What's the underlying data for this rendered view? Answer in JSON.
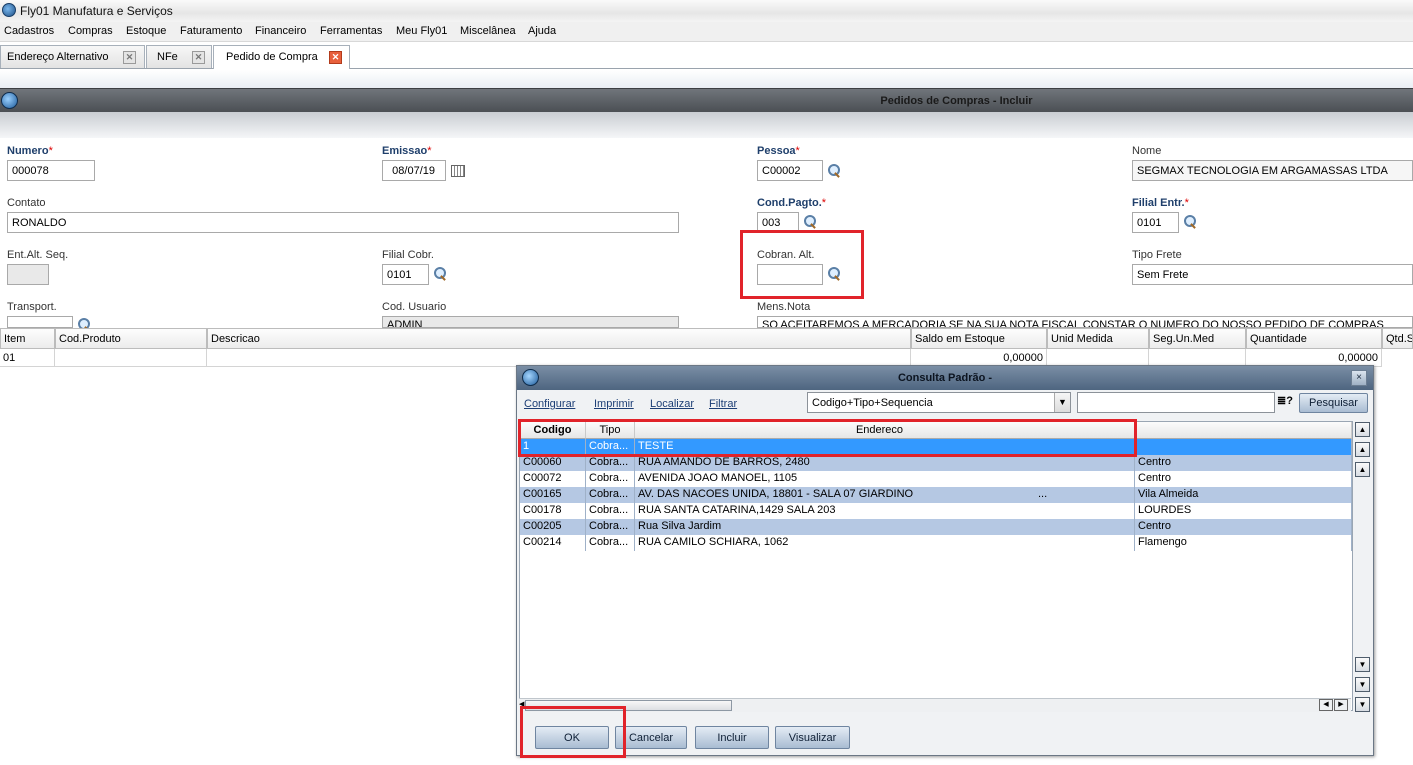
{
  "window": {
    "title": "Fly01 Manufatura e Serviços"
  },
  "menu": [
    "Cadastros",
    "Compras",
    "Estoque",
    "Faturamento",
    "Financeiro",
    "Ferramentas",
    "Meu Fly01",
    "Miscelânea",
    "Ajuda"
  ],
  "tabs": [
    {
      "label": "Endereço Alternativo"
    },
    {
      "label": "NFe"
    },
    {
      "label": "Pedido de Compra"
    }
  ],
  "form": {
    "title": "Pedidos de Compras - Incluir",
    "numero": {
      "label": "Numero",
      "value": "000078"
    },
    "emissao": {
      "label": "Emissao",
      "value": "08/07/19"
    },
    "pessoa": {
      "label": "Pessoa",
      "value": "C00002"
    },
    "nome": {
      "label": "Nome",
      "value": "SEGMAX TECNOLOGIA EM ARGAMASSAS LTDA"
    },
    "contato": {
      "label": "Contato",
      "value": "RONALDO"
    },
    "cond_pagto": {
      "label": "Cond.Pagto.",
      "value": "003"
    },
    "filial_entr": {
      "label": "Filial Entr.",
      "value": "0101"
    },
    "ent_alt_seq": {
      "label": "Ent.Alt. Seq.",
      "value": ""
    },
    "filial_cobr": {
      "label": "Filial Cobr.",
      "value": "0101"
    },
    "cobran_alt": {
      "label": "Cobran. Alt.",
      "value": ""
    },
    "tipo_frete": {
      "label": "Tipo Frete",
      "value": "Sem Frete"
    },
    "transport": {
      "label": "Transport.",
      "value": ""
    },
    "cod_usuario": {
      "label": "Cod. Usuario",
      "value": "ADMIN"
    },
    "mens_nota": {
      "label": "Mens.Nota",
      "value": "SO ACEITAREMOS A MERCADORIA SE NA SUA NOTA FISCAL CONSTAR O NUMERO DO NOSSO PEDIDO DE COMPRAS"
    },
    "required_mark": "*"
  },
  "grid": {
    "headers": [
      "Item",
      "Cod.Produto",
      "Descricao",
      "Saldo em Estoque",
      "Unid Medida",
      "Seg.Un.Med",
      "Quantidade",
      "Qtd.S"
    ],
    "row": [
      "01",
      "",
      "",
      "0,00000",
      "",
      "",
      "0,00000",
      ""
    ]
  },
  "dialog": {
    "title": "Consulta Padrão -",
    "close": "×",
    "links": [
      "Configurar",
      "Imprimir",
      "Localizar",
      "Filtrar"
    ],
    "order_select": "Codigo+Tipo+Sequencia",
    "search_value": "",
    "search_button": "Pesquisar",
    "columns": [
      "Codigo",
      "Tipo",
      "Endereco"
    ],
    "rows": [
      {
        "codigo": "1",
        "tipo": "Cobra...",
        "endereco": "TESTE",
        "bairro": "",
        "selected": true
      },
      {
        "codigo": "C00060",
        "tipo": "Cobra...",
        "endereco": "RUA AMANDO DE BARROS, 2480",
        "bairro": "Centro"
      },
      {
        "codigo": "C00072",
        "tipo": "Cobra...",
        "endereco": "AVENIDA JOAO MANOEL, 1105",
        "bairro": "Centro"
      },
      {
        "codigo": "C00165",
        "tipo": "Cobra...",
        "endereco": "AV. DAS NACOES UNIDA, 18801 - SALA 07 GIARDINO",
        "extra": "...",
        "bairro": "Vila Almeida"
      },
      {
        "codigo": "C00178",
        "tipo": "Cobra...",
        "endereco": "RUA SANTA CATARINA,1429 SALA 203",
        "bairro": "LOURDES"
      },
      {
        "codigo": "C00205",
        "tipo": "Cobra...",
        "endereco": "Rua Silva Jardim",
        "bairro": "Centro"
      },
      {
        "codigo": "C00214",
        "tipo": "Cobra...",
        "endereco": "RUA CAMILO SCHIARA, 1062",
        "bairro": "Flamengo"
      }
    ],
    "buttons": {
      "ok": "OK",
      "cancel": "Cancelar",
      "include": "Incluir",
      "view": "Visualizar"
    }
  }
}
